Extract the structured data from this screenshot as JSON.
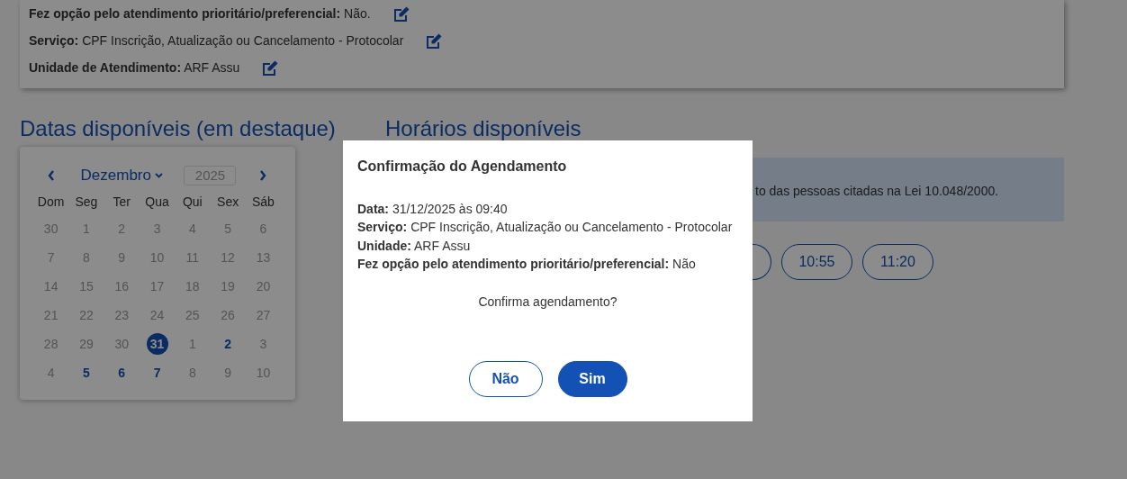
{
  "summary": {
    "rows": [
      {
        "text": "**Fez opção pelo atendimento prioritário/preferencial:** Não."
      },
      {
        "text": "**Serviço:** CPF Inscrição, Atualização ou Cancelamento - Protocolar"
      },
      {
        "text": "**Unidade de Atendimento:** ARF Assu"
      }
    ]
  },
  "dates_heading": "Datas disponíveis (em destaque)",
  "times_heading": "Horários disponíveis",
  "calendar": {
    "month": "Dezembro",
    "year": "2025",
    "weekdays": [
      "Dom",
      "Seg",
      "Ter",
      "Qua",
      "Qui",
      "Sex",
      "Sáb"
    ],
    "weeks": [
      [
        {
          "day": "30",
          "kind": "muted",
          "selected": false
        },
        {
          "day": "1",
          "kind": "muted",
          "selected": false
        },
        {
          "day": "2",
          "kind": "muted",
          "selected": false
        },
        {
          "day": "3",
          "kind": "muted",
          "selected": false
        },
        {
          "day": "4",
          "kind": "muted",
          "selected": false
        },
        {
          "day": "5",
          "kind": "muted",
          "selected": false
        },
        {
          "day": "6",
          "kind": "muted",
          "selected": false
        }
      ],
      [
        {
          "day": "7",
          "kind": "muted",
          "selected": false
        },
        {
          "day": "8",
          "kind": "muted",
          "selected": false
        },
        {
          "day": "9",
          "kind": "muted",
          "selected": false
        },
        {
          "day": "10",
          "kind": "muted",
          "selected": false
        },
        {
          "day": "11",
          "kind": "muted",
          "selected": false
        },
        {
          "day": "12",
          "kind": "muted",
          "selected": false
        },
        {
          "day": "13",
          "kind": "muted",
          "selected": false
        }
      ],
      [
        {
          "day": "14",
          "kind": "muted",
          "selected": false
        },
        {
          "day": "15",
          "kind": "muted",
          "selected": false
        },
        {
          "day": "16",
          "kind": "muted",
          "selected": false
        },
        {
          "day": "17",
          "kind": "muted",
          "selected": false
        },
        {
          "day": "18",
          "kind": "muted",
          "selected": false
        },
        {
          "day": "19",
          "kind": "muted",
          "selected": false
        },
        {
          "day": "20",
          "kind": "muted",
          "selected": false
        }
      ],
      [
        {
          "day": "21",
          "kind": "muted",
          "selected": false
        },
        {
          "day": "22",
          "kind": "muted",
          "selected": false
        },
        {
          "day": "23",
          "kind": "muted",
          "selected": false
        },
        {
          "day": "24",
          "kind": "muted",
          "selected": false
        },
        {
          "day": "25",
          "kind": "muted",
          "selected": false
        },
        {
          "day": "26",
          "kind": "muted",
          "selected": false
        },
        {
          "day": "27",
          "kind": "muted",
          "selected": false
        }
      ],
      [
        {
          "day": "28",
          "kind": "muted",
          "selected": false
        },
        {
          "day": "29",
          "kind": "muted",
          "selected": false
        },
        {
          "day": "30",
          "kind": "muted",
          "selected": false
        },
        {
          "day": "31",
          "kind": "available",
          "selected": true
        },
        {
          "day": "1",
          "kind": "muted",
          "selected": false
        },
        {
          "day": "2",
          "kind": "available",
          "selected": false
        },
        {
          "day": "3",
          "kind": "muted",
          "selected": false
        }
      ],
      [
        {
          "day": "4",
          "kind": "muted",
          "selected": false
        },
        {
          "day": "5",
          "kind": "available",
          "selected": false
        },
        {
          "day": "6",
          "kind": "available",
          "selected": false
        },
        {
          "day": "7",
          "kind": "available",
          "selected": false
        },
        {
          "day": "8",
          "kind": "muted",
          "selected": false
        },
        {
          "day": "9",
          "kind": "muted",
          "selected": false
        },
        {
          "day": "10",
          "kind": "muted",
          "selected": false
        }
      ]
    ]
  },
  "info": {
    "text": "to das pessoas citadas na Lei 10.048/2000."
  },
  "time_slots": [
    {
      "kind": "partial"
    },
    {
      "kind": "full",
      "label": "10:55"
    },
    {
      "kind": "full",
      "label": "11:20"
    }
  ],
  "dialog": {
    "title": "Confirmação do Agendamento",
    "lines": [
      {
        "text": "**Data:** 31/12/2025 às 09:40"
      },
      {
        "text": "**Serviço:** CPF Inscrição, Atualização ou Cancelamento - Protocolar"
      },
      {
        "text": "**Unidade:** ARF Assu"
      },
      {
        "text": "**Fez opção pelo atendimento prioritário/preferencial:** Não"
      }
    ],
    "question": "Confirma agendamento?",
    "buttons": [
      {
        "label": "Não",
        "kind": "secondary"
      },
      {
        "label": "Sim",
        "kind": "primary"
      }
    ]
  }
}
